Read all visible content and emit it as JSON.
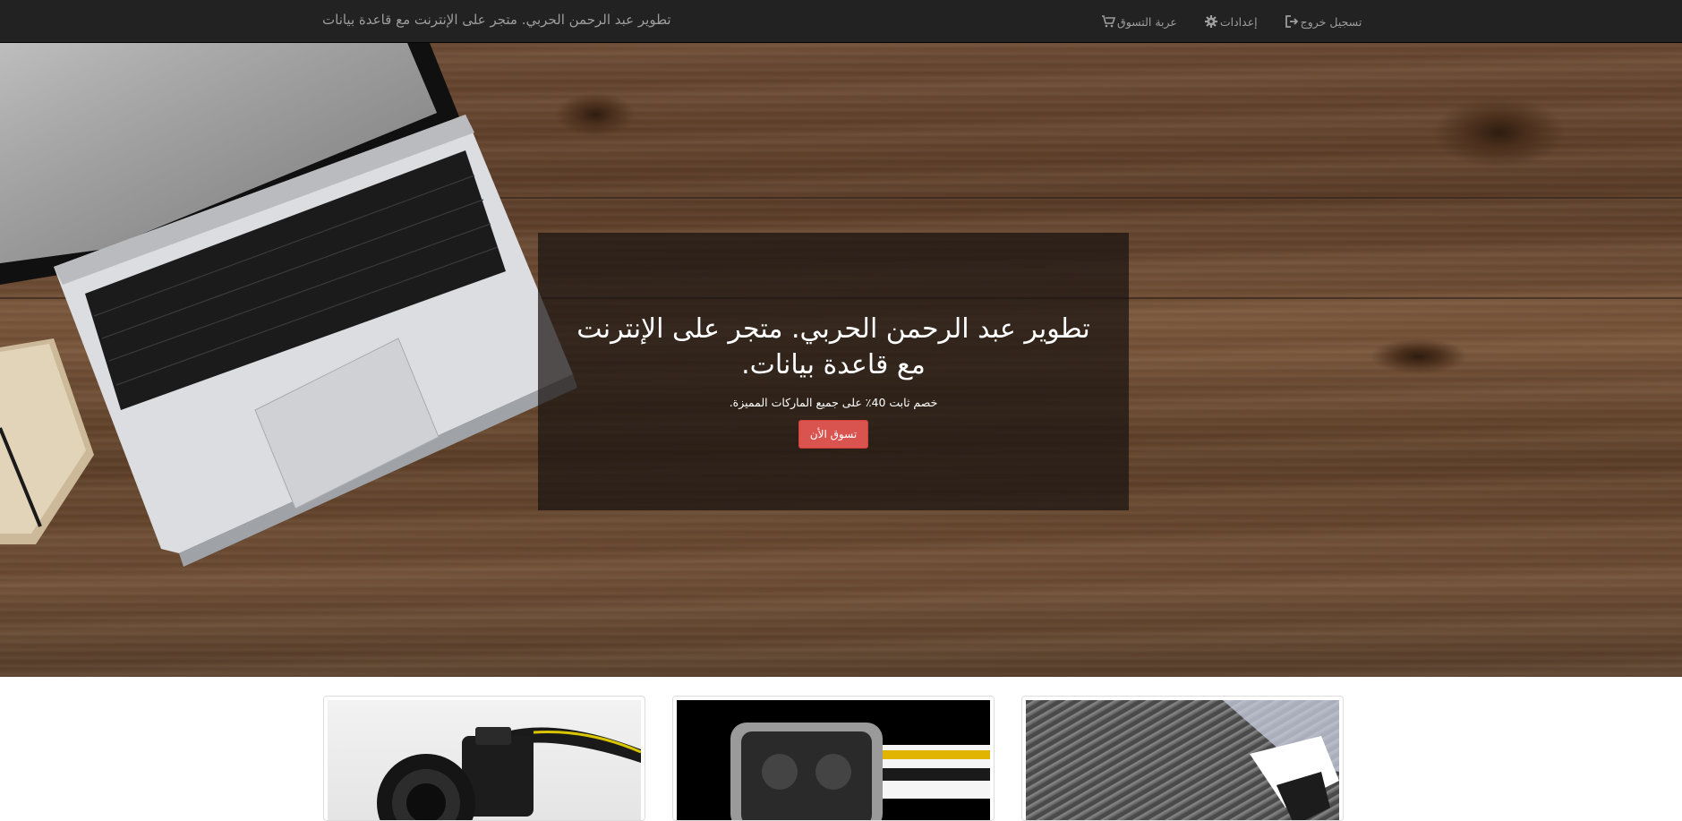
{
  "navbar": {
    "brand": "تطوير عبد الرحمن الحربي. متجر على الإنترنت مع قاعدة بيانات",
    "links": [
      {
        "label": "تسجيل خروج",
        "icon": "logout-icon"
      },
      {
        "label": "إعدادات",
        "icon": "gear-icon"
      },
      {
        "label": "عربة التسوق",
        "icon": "shopping-cart-icon"
      }
    ]
  },
  "hero": {
    "title": "تطوير عبد الرحمن الحربي. متجر على الإنترنت مع قاعدة بيانات.",
    "subtitle": "خصم ثابت 40٪ على جميع الماركات المميزة.",
    "button_label": "تسوق الأن"
  },
  "products": [
    {
      "image": "camera-image"
    },
    {
      "image": "watch-image"
    },
    {
      "image": "shirt-image"
    }
  ],
  "colors": {
    "navbar_bg": "#222222",
    "navbar_text": "#9d9d9d",
    "accent_button": "#d9534f",
    "panel_overlay": "rgba(25,20,17,0.72)"
  }
}
